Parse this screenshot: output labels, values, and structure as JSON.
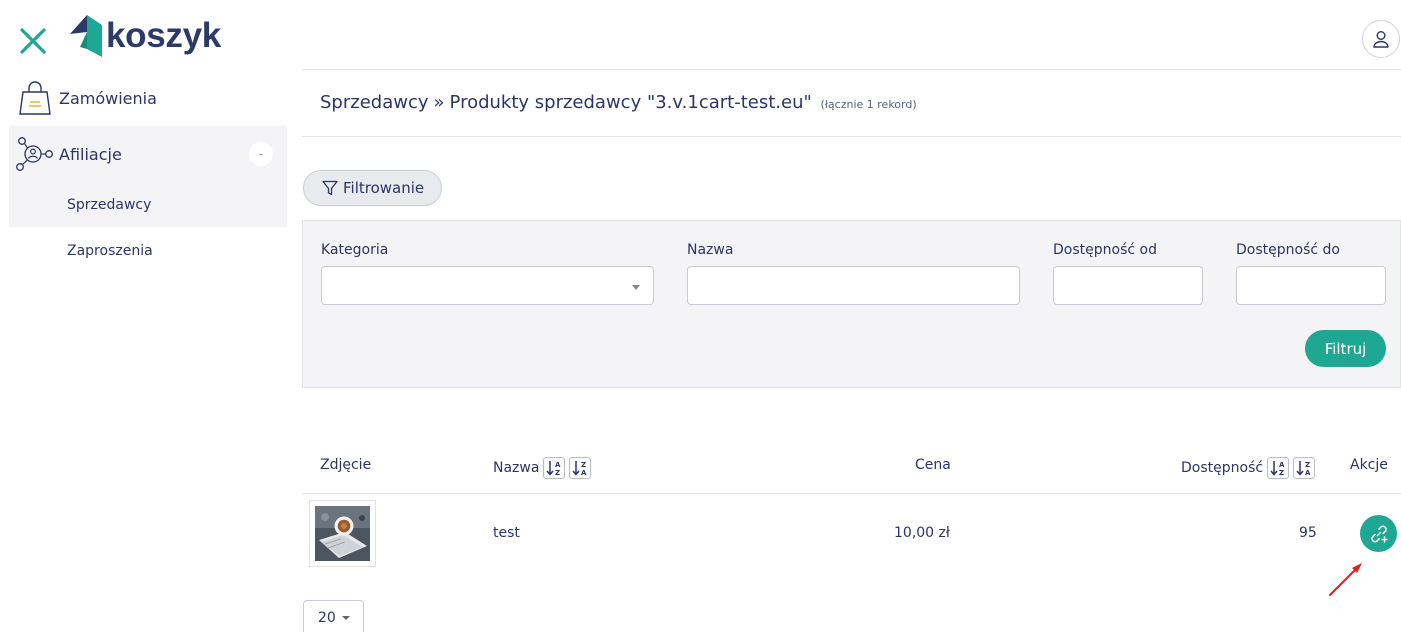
{
  "brand": {
    "name": "koszyk",
    "accent": "#1ea793",
    "primary_text": "#2b3566"
  },
  "sidebar": {
    "items": [
      {
        "label": "Zamówienia",
        "icon": "shopping-bag-icon"
      },
      {
        "label": "Afiliacje",
        "icon": "affiliate-network-icon",
        "toggle": "-",
        "children": [
          {
            "label": "Sprzedawcy",
            "active": true
          },
          {
            "label": "Zaproszenia"
          }
        ]
      }
    ]
  },
  "header": {
    "breadcrumb": {
      "parent": "Sprzedawcy",
      "separator": "»",
      "current": "Produkty sprzedawcy \"3.v.1cart-test.eu\"",
      "count_note": "(łącznie 1 rekord)"
    }
  },
  "filters": {
    "toggle_label": "Filtrowanie",
    "fields": {
      "category": {
        "label": "Kategoria",
        "value": ""
      },
      "name": {
        "label": "Nazwa",
        "value": ""
      },
      "availability_from": {
        "label": "Dostępność od",
        "value": ""
      },
      "availability_to": {
        "label": "Dostępność do",
        "value": ""
      }
    },
    "submit_label": "Filtruj"
  },
  "table": {
    "columns": {
      "photo": "Zdjęcie",
      "name": "Nazwa",
      "price": "Cena",
      "availability": "Dostępność",
      "actions": "Akcje"
    },
    "rows": [
      {
        "name": "test",
        "price": "10,00 zł",
        "availability": "95"
      }
    ]
  },
  "pagination": {
    "page_size": "20"
  }
}
